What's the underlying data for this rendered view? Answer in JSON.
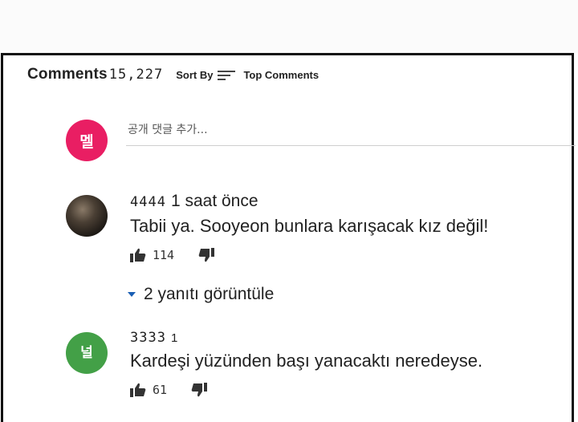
{
  "header": {
    "title": "Comments",
    "count": "15,227",
    "sort_label": "Sort By",
    "sort_option": "Top Comments"
  },
  "add_comment": {
    "avatar_text": "멜",
    "placeholder": "공개 댓글 추가..."
  },
  "comments": [
    {
      "author": "4444",
      "time": "1 saat önce",
      "text": "Tabii ya. Sooyeon bunlara karışacak kız değil!",
      "likes": "114",
      "replies_label": "2 yanıtı görüntüle"
    },
    {
      "avatar_text": "널",
      "author": "3333",
      "time": "1",
      "text": "Kardeşi yüzünden başı yanacaktı neredeyse.",
      "likes": "61"
    }
  ],
  "icons": {
    "sort": "sort-lines-icon",
    "like": "thumbs-up-icon",
    "dislike": "thumbs-down-icon",
    "expand": "caret-down-icon"
  },
  "colors": {
    "avatar_mel": "#e91e63",
    "avatar_neol": "#43a047",
    "caret": "#1a5fb4"
  }
}
